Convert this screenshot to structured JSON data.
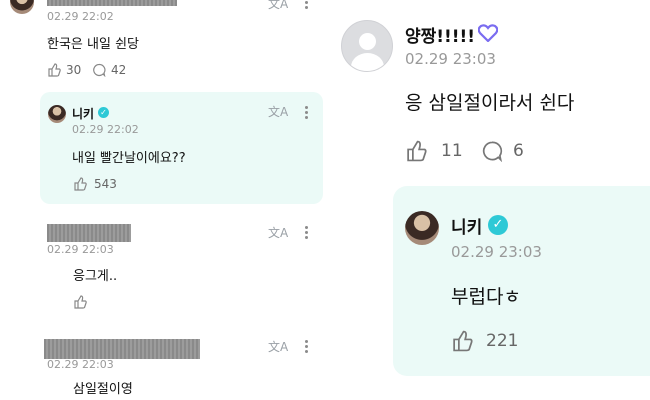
{
  "left": {
    "comments": [
      {
        "time": "02.29 22:02",
        "text": "한국은 내일 쉰당",
        "likes": "30",
        "replies": "42"
      },
      {
        "author": "니키",
        "time": "02.29 22:02",
        "text": "내일 빨간날이에요??",
        "likes": "543"
      },
      {
        "time": "02.29 22:03",
        "text": "응그게.."
      },
      {
        "time": "02.29 22:03",
        "text": "삼일절이영"
      }
    ]
  },
  "right": {
    "comments": [
      {
        "author": "양짱!!!!!",
        "time": "02.29 23:03",
        "text": "응 삼일절이라서 쉰다",
        "likes": "11",
        "replies": "6"
      },
      {
        "author": "니키",
        "time": "02.29 23:03",
        "text": "부럽다ㅎ",
        "likes": "221"
      }
    ]
  },
  "icons": {
    "translate": "文A",
    "like": "like-icon",
    "reply": "reply-icon",
    "more": "more-icon"
  },
  "colors": {
    "highlight_bg": "#ebfaf7",
    "verified": "#2ec9d6",
    "badge": "#7a6cf0"
  }
}
